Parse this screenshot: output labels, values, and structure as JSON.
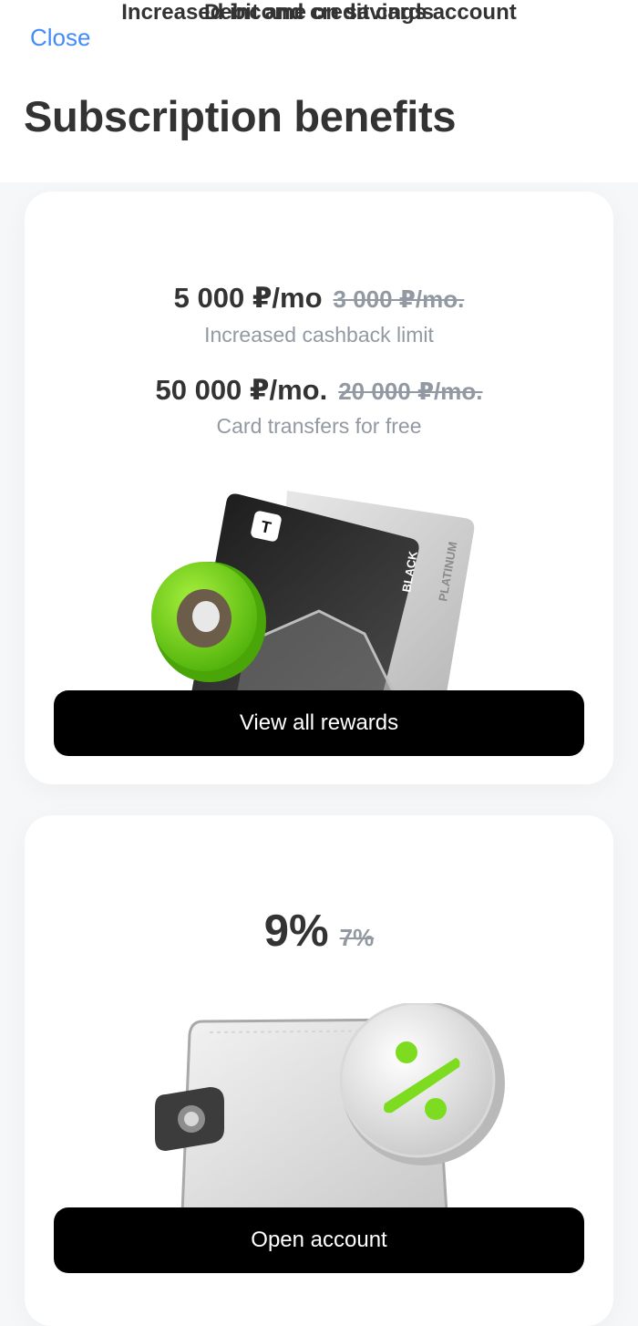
{
  "header": {
    "close_label": "Close",
    "title": "Subscription benefits"
  },
  "cards_section": {
    "title": "Debit and credit cards",
    "benefits": [
      {
        "value": "5 000 ₽/mo",
        "old_value": "3 000 ₽/mo.",
        "caption": "Increased cashback limit"
      },
      {
        "value": "50 000 ₽/mo.",
        "old_value": "20 000 ₽/mo.",
        "caption": "Card transfers for free"
      }
    ],
    "card_labels": {
      "front": "BLACK",
      "back": "PLATINUM",
      "logo": "T"
    },
    "button_label": "View all rewards"
  },
  "savings_section": {
    "title": "Increased income on savings account",
    "value": "9%",
    "old_value": "7%",
    "button_label": "Open account"
  },
  "colors": {
    "accent_link": "#428bf9",
    "accent_green": "#7ddc1f",
    "muted_text": "#9299a2",
    "button_bg": "#000000"
  }
}
